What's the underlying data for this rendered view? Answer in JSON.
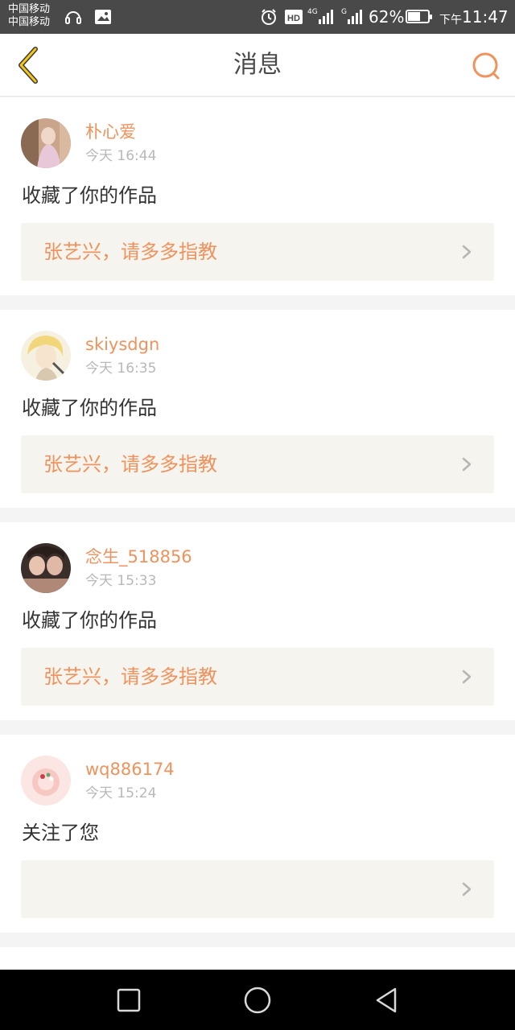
{
  "status_bar": {
    "carrier_1": "中国移动",
    "carrier_2": "中国移动",
    "network_4g": "4G",
    "network_g": "G",
    "battery_text": "62%",
    "battery_level": 0.62,
    "ampm": "下午",
    "time": "11:47",
    "icons": [
      "headset-icon",
      "image-icon",
      "alarm-icon",
      "hd-icon",
      "signal-icon",
      "signal-icon",
      "battery-icon"
    ]
  },
  "header": {
    "title": "消息",
    "back_icon": "chevron-left-icon",
    "search_icon": "search-icon",
    "accent_color": "#f0925c"
  },
  "messages": [
    {
      "username": "朴心爱",
      "time": "今天 16:44",
      "action": "收藏了你的作品",
      "work_title": "张艺兴，请多多指教"
    },
    {
      "username": "skiysdgn",
      "time": "今天 16:35",
      "action": "收藏了你的作品",
      "work_title": "张艺兴，请多多指教"
    },
    {
      "username": "念生_518856",
      "time": "今天 15:33",
      "action": "收藏了你的作品",
      "work_title": "张艺兴，请多多指教"
    },
    {
      "username": "wq886174",
      "time": "今天 15:24",
      "action": "关注了您",
      "work_title": ""
    }
  ],
  "nav_bar": {
    "icons": [
      "recent-apps-icon",
      "home-icon",
      "back-icon"
    ]
  }
}
